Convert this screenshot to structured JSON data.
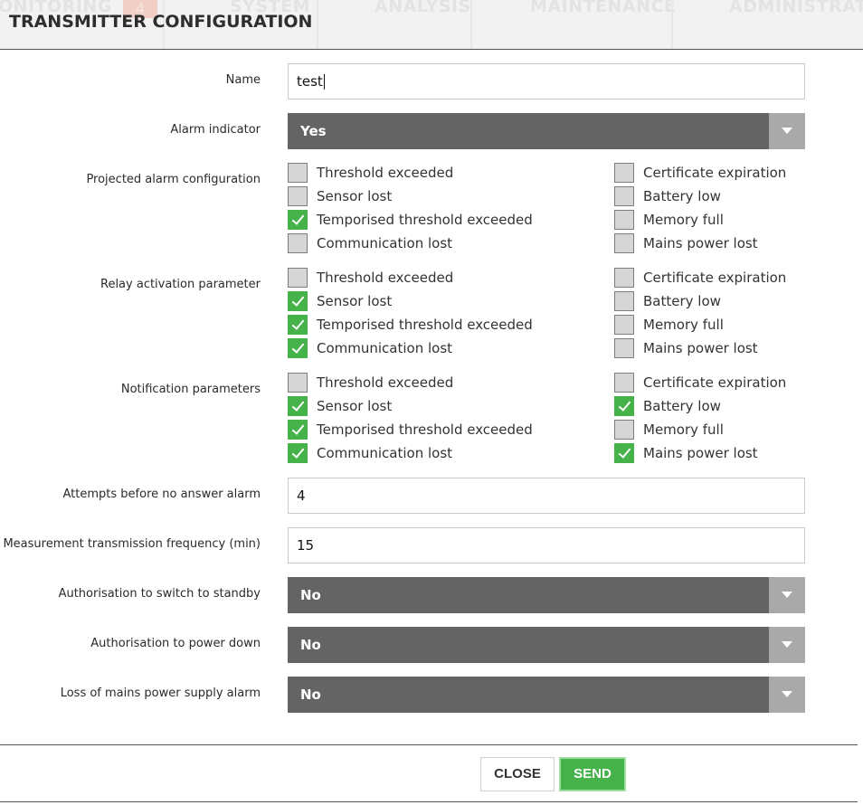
{
  "background_nav": {
    "items": [
      "ONITORING",
      "SYSTEM",
      "ANALYSIS",
      "MAINTENANCE",
      "ADMINISTRATION"
    ],
    "badge": "4"
  },
  "modal": {
    "title": "TRANSMITTER CONFIGURATION"
  },
  "fields": {
    "name": {
      "label": "Name",
      "value": "test"
    },
    "alarm_indicator": {
      "label": "Alarm indicator",
      "value": "Yes"
    },
    "attempts": {
      "label": "Attempts before no answer alarm",
      "value": "4"
    },
    "frequency": {
      "label": "Measurement transmission frequency (min)",
      "value": "15"
    },
    "standby": {
      "label": "Authorisation to switch to standby",
      "value": "No"
    },
    "power_down": {
      "label": "Authorisation to power down",
      "value": "No"
    },
    "mains_alarm": {
      "label": "Loss of mains power supply alarm",
      "value": "No"
    }
  },
  "checkbox_groups": [
    {
      "label": "Projected alarm configuration",
      "left": [
        {
          "label": "Threshold exceeded",
          "checked": false
        },
        {
          "label": "Sensor lost",
          "checked": false
        },
        {
          "label": "Temporised threshold exceeded",
          "checked": true
        },
        {
          "label": "Communication lost",
          "checked": false
        }
      ],
      "right": [
        {
          "label": "Certificate expiration",
          "checked": false
        },
        {
          "label": "Battery low",
          "checked": false
        },
        {
          "label": "Memory full",
          "checked": false
        },
        {
          "label": "Mains power lost",
          "checked": false
        }
      ]
    },
    {
      "label": "Relay activation parameter",
      "left": [
        {
          "label": "Threshold exceeded",
          "checked": false
        },
        {
          "label": "Sensor lost",
          "checked": true
        },
        {
          "label": "Temporised threshold exceeded",
          "checked": true
        },
        {
          "label": "Communication lost",
          "checked": true
        }
      ],
      "right": [
        {
          "label": "Certificate expiration",
          "checked": false
        },
        {
          "label": "Battery low",
          "checked": false
        },
        {
          "label": "Memory full",
          "checked": false
        },
        {
          "label": "Mains power lost",
          "checked": false
        }
      ]
    },
    {
      "label": "Notification parameters",
      "left": [
        {
          "label": "Threshold exceeded",
          "checked": false
        },
        {
          "label": "Sensor lost",
          "checked": true
        },
        {
          "label": "Temporised threshold exceeded",
          "checked": true
        },
        {
          "label": "Communication lost",
          "checked": true
        }
      ],
      "right": [
        {
          "label": "Certificate expiration",
          "checked": false
        },
        {
          "label": "Battery low",
          "checked": true
        },
        {
          "label": "Memory full",
          "checked": false
        },
        {
          "label": "Mains power lost",
          "checked": true
        }
      ]
    }
  ],
  "buttons": {
    "close": "CLOSE",
    "send": "SEND"
  },
  "colors": {
    "checked": "#45b24a",
    "select_bg": "#646464",
    "select_arrow_bg": "#a9a9a9"
  },
  "icons": [
    "chevron-down-icon",
    "checkmark-icon"
  ]
}
